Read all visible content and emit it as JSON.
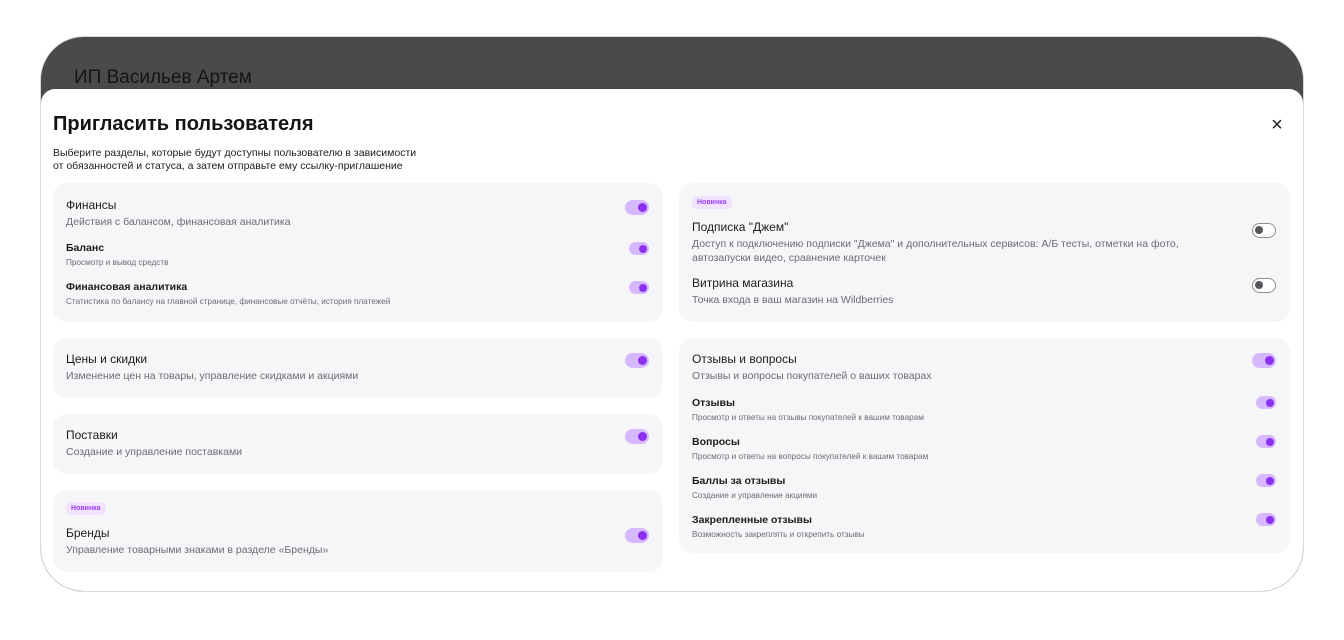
{
  "background": {
    "title": "ИП Васильев Артем"
  },
  "modal": {
    "title": "Пригласить пользователя",
    "subtitle_line1": "Выберите разделы, которые будут доступны пользователю в зависимости",
    "subtitle_line2": "от обязанностей и статуса, а затем отправьте ему ссылку-приглашение",
    "close_glyph": "×"
  },
  "badge_new": "Новинка",
  "finance": {
    "title": "Финансы",
    "desc": "Действия с балансом, финансовая аналитика",
    "enabled": true,
    "balance": {
      "title": "Баланс",
      "desc": "Просмотр и вывод средств",
      "enabled": true
    },
    "analytics": {
      "title": "Финансовая аналитика",
      "desc": "Статистика по балансу на главной странице, финансовые отчёты, история платежей",
      "enabled": true
    }
  },
  "prices": {
    "title": "Цены и скидки",
    "desc": "Изменение цен на товары, управление скидками и акциями",
    "enabled": true
  },
  "supplies": {
    "title": "Поставки",
    "desc": "Создание и управление поставками",
    "enabled": true
  },
  "brands": {
    "title": "Бренды",
    "desc": "Управление товарными знаками в разделе «Бренды»",
    "enabled": true
  },
  "jam": {
    "title": "Подписка \"Джем\"",
    "desc_line1": "Доступ к подключению подписки \"Джема\" и дополнительных сервисов: А/Б тесты, отметки на фото,",
    "desc_line2": "автозапуски видео, сравнение карточек",
    "enabled": false
  },
  "showcase": {
    "title": "Витрина магазина",
    "desc": "Точка входа в ваш магазин на Wildberries",
    "enabled": false
  },
  "feedback": {
    "title": "Отзывы и вопросы",
    "desc": "Отзывы и вопросы покупателей о ваших товарах",
    "enabled": true,
    "reviews": {
      "title": "Отзывы",
      "desc": "Просмотр и ответы на отзывы покупателей к вашим товарам",
      "enabled": true
    },
    "questions": {
      "title": "Вопросы",
      "desc": "Просмотр и ответы на вопросы покупателей к вашим товарам",
      "enabled": true
    },
    "points": {
      "title": "Баллы за отзывы",
      "desc": "Создание и управление акциями",
      "enabled": true
    },
    "pinned": {
      "title": "Закрепленные отзывы",
      "desc": "Возможность закреплять и открепить отзывы",
      "enabled": true
    }
  }
}
